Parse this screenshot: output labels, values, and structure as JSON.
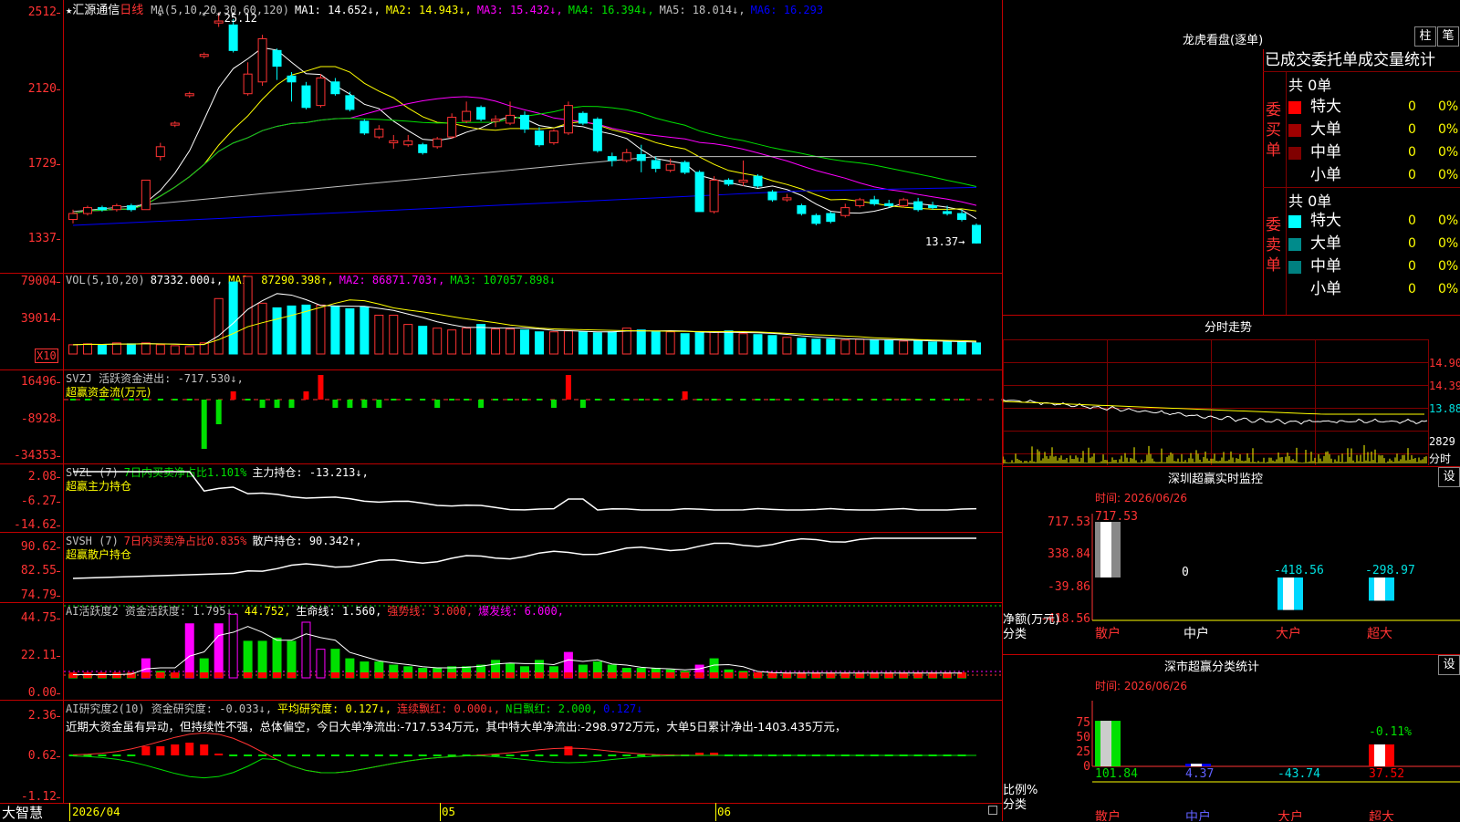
{
  "stock": {
    "star": "★",
    "name": "汇源通信",
    "period": "日线"
  },
  "main_legend": [
    {
      "t": "MA(5,10,20,30,60,120)",
      "c": "#c0c0c0"
    },
    {
      "t": "MA1: 14.652↓,",
      "c": "#ffffff"
    },
    {
      "t": "MA2: 14.943↓,",
      "c": "#ffff00"
    },
    {
      "t": "MA3: 15.432↓,",
      "c": "#ff00ff"
    },
    {
      "t": "MA4: 16.394↓,",
      "c": "#00e000"
    },
    {
      "t": "MA5: 18.014↓,",
      "c": "#c0c0c0"
    },
    {
      "t": "MA6: 16.293",
      "c": "#0000ff"
    }
  ],
  "high_label": "25.12",
  "last_label": "13.37→",
  "main_axis": [
    "2512",
    "2120",
    "1729",
    "1337"
  ],
  "vol_legend": [
    {
      "t": "VOL(5,10,20)",
      "c": "#c0c0c0"
    },
    {
      "t": "87332.000↓,",
      "c": "#ffffff"
    },
    {
      "t": "MA1: 87290.398↑,",
      "c": "#ffff00"
    },
    {
      "t": "MA2: 86871.703↑,",
      "c": "#ff00ff"
    },
    {
      "t": "MA3: 107057.898↓",
      "c": "#00e000"
    }
  ],
  "vol_axis": [
    "79004",
    "39014"
  ],
  "vol_unit": "X10",
  "svzj_legend": [
    {
      "t": "SVZJ  活跃资金进出: -717.530↓,",
      "c": "#c0c0c0"
    }
  ],
  "svzj_sub": "超赢资金流(万元)",
  "svzj_axis": [
    "16496",
    "-8928",
    "-34353"
  ],
  "svzl_legend": [
    {
      "t": "SVZL (7)",
      "c": "#c0c0c0"
    },
    {
      "t": "7日内买卖净占比1.101%",
      "c": "#00e000"
    },
    {
      "t": "主力持仓: -13.213↓,",
      "c": "#ffffff"
    }
  ],
  "svzl_sub": "超赢主力持仓",
  "svzl_axis": [
    "2.08",
    "-6.27",
    "-14.62"
  ],
  "svsh_legend": [
    {
      "t": "SVSH (7)",
      "c": "#c0c0c0"
    },
    {
      "t": "7日内买卖净占比0.835%",
      "c": "#ff3333"
    },
    {
      "t": "散户持仓: 90.342↑,",
      "c": "#ffffff"
    }
  ],
  "svsh_sub": "超赢散户持仓",
  "svsh_axis": [
    "90.62",
    "82.55",
    "74.79"
  ],
  "ai1_legend": [
    {
      "t": "AI活跃度2 资金活跃度: 1.795↓,",
      "c": "#c0c0c0"
    },
    {
      "t": "44.752,",
      "c": "#ffff00"
    },
    {
      "t": "生命线: 1.560,",
      "c": "#ffffff"
    },
    {
      "t": "强势线: 3.000,",
      "c": "#ff3333"
    },
    {
      "t": "爆发线: 6.000,",
      "c": "#ff00ff"
    }
  ],
  "ai1_axis": [
    "44.75",
    "22.11",
    "0.00"
  ],
  "ai2_legend": [
    {
      "t": "AI研究度2(10) 资金研究度: -0.033↓,",
      "c": "#c0c0c0"
    },
    {
      "t": "平均研究度: 0.127↓,",
      "c": "#ffff00"
    },
    {
      "t": "连续飘红: 0.000↓,",
      "c": "#ff3333"
    },
    {
      "t": "N日飘红: 2.000,",
      "c": "#00e000"
    },
    {
      "t": "0.127↓",
      "c": "#0000ff"
    }
  ],
  "ai2_note": "近期大资金虽有异动，但持续性不强，总体偏空，今日大单净流出:-717.534万元，其中特大单净流出:-298.972万元，大单5日累计净出-1403.435万元，",
  "ai2_axis": [
    "2.36",
    "0.62",
    "-1.12"
  ],
  "date_axis": [
    "2026/04",
    "05",
    "06"
  ],
  "brand": "大智慧",
  "lhb": {
    "title": "龙虎看盘(逐单)",
    "btn_bar": "柱",
    "btn_pen": "笔",
    "header": "已成交委托单成交量统计",
    "buy": {
      "side": "委买单",
      "total": "共 0单",
      "rows": [
        {
          "name": "特大",
          "v": "0",
          "p": "0%",
          "c": "#ff0000"
        },
        {
          "name": "大单",
          "v": "0",
          "p": "0%",
          "c": "#a00000"
        },
        {
          "name": "中单",
          "v": "0",
          "p": "0%",
          "c": "#800000"
        },
        {
          "name": "小单",
          "v": "0",
          "p": "0%",
          "c": ""
        }
      ]
    },
    "sell": {
      "side": "委卖单",
      "total": "共 0单",
      "rows": [
        {
          "name": "特大",
          "v": "0",
          "p": "0%",
          "c": "#00ffff"
        },
        {
          "name": "大单",
          "v": "0",
          "p": "0%",
          "c": "#008b8b"
        },
        {
          "name": "中单",
          "v": "0",
          "p": "0%",
          "c": "#008080"
        },
        {
          "name": "小单",
          "v": "0",
          "p": "0%",
          "c": ""
        }
      ]
    }
  },
  "intraday": {
    "title": "分时走势",
    "axis": [
      "14.90",
      "14.39",
      "13.88",
      "2829"
    ],
    "unit": "分时"
  },
  "sz_monitor": {
    "title": "深圳超赢实时监控",
    "btn": "设",
    "time": "时间: 2026/06/26",
    "axis": [
      "717.53",
      "338.84",
      "-39.86",
      "-418.56"
    ],
    "ylabel": "净额(万元)",
    "xlabel": "分类",
    "cats": [
      "散户",
      "中户",
      "大户",
      "超大"
    ],
    "values": [
      717.53,
      0,
      -418.56,
      -298.97
    ],
    "value_labels": [
      "717.53",
      "0",
      "-418.56",
      "-298.97"
    ]
  },
  "sz_class": {
    "title": "深市超赢分类统计",
    "btn": "设",
    "time": "时间: 2026/06/26",
    "axis": [
      "75",
      "50",
      "25",
      "0"
    ],
    "ylabel": "比例%",
    "xlabel": "分类",
    "cats": [
      "散户",
      "中户",
      "大户",
      "超大"
    ],
    "values": [
      101.84,
      4.37,
      -43.74,
      37.52
    ],
    "value_labels": [
      "101.84",
      "4.37",
      "-43.74",
      "37.52"
    ],
    "extra_label": "-0.11%"
  },
  "chart_data": {
    "type": "candlestick",
    "title": "汇源通信 日线",
    "ylim": [
      13.37,
      25.12
    ],
    "candles": [
      {
        "o": 14.6,
        "c": 14.9,
        "h": 15.1,
        "l": 14.4
      },
      {
        "o": 14.9,
        "c": 15.2,
        "h": 15.3,
        "l": 14.8
      },
      {
        "o": 15.2,
        "c": 15.1,
        "h": 15.3,
        "l": 15.0
      },
      {
        "o": 15.1,
        "c": 15.3,
        "h": 15.4,
        "l": 15.0
      },
      {
        "o": 15.3,
        "c": 15.1,
        "h": 15.4,
        "l": 15.0
      },
      {
        "o": 15.1,
        "c": 16.6,
        "h": 16.6,
        "l": 15.1
      },
      {
        "o": 17.8,
        "c": 18.3,
        "h": 18.5,
        "l": 17.6
      },
      {
        "o": 19.4,
        "c": 19.5,
        "h": 19.6,
        "l": 19.3
      },
      {
        "o": 20.9,
        "c": 21.0,
        "h": 21.1,
        "l": 20.8
      },
      {
        "o": 22.9,
        "c": 23.0,
        "h": 23.1,
        "l": 22.8
      },
      {
        "o": 24.6,
        "c": 24.7,
        "h": 25.12,
        "l": 24.4
      },
      {
        "o": 24.5,
        "c": 23.2,
        "h": 24.8,
        "l": 23.1
      },
      {
        "o": 21.0,
        "c": 22.0,
        "h": 22.6,
        "l": 20.9
      },
      {
        "o": 21.6,
        "c": 23.8,
        "h": 24.0,
        "l": 21.4
      },
      {
        "o": 23.2,
        "c": 22.4,
        "h": 23.3,
        "l": 21.7
      },
      {
        "o": 21.9,
        "c": 21.6,
        "h": 22.1,
        "l": 20.6
      },
      {
        "o": 21.4,
        "c": 20.3,
        "h": 21.6,
        "l": 20.2
      },
      {
        "o": 20.4,
        "c": 21.8,
        "h": 22.0,
        "l": 20.3
      },
      {
        "o": 21.6,
        "c": 21.0,
        "h": 21.8,
        "l": 20.9
      },
      {
        "o": 20.9,
        "c": 20.2,
        "h": 21.1,
        "l": 20.1
      },
      {
        "o": 19.6,
        "c": 19.0,
        "h": 19.7,
        "l": 18.9
      },
      {
        "o": 18.8,
        "c": 19.2,
        "h": 19.4,
        "l": 18.7
      },
      {
        "o": 18.5,
        "c": 18.6,
        "h": 18.9,
        "l": 18.2
      },
      {
        "o": 18.4,
        "c": 18.6,
        "h": 18.9,
        "l": 18.3
      },
      {
        "o": 18.4,
        "c": 18.0,
        "h": 18.5,
        "l": 17.9
      },
      {
        "o": 18.3,
        "c": 18.7,
        "h": 18.8,
        "l": 18.2
      },
      {
        "o": 18.8,
        "c": 19.8,
        "h": 20.0,
        "l": 18.7
      },
      {
        "o": 19.6,
        "c": 20.1,
        "h": 20.6,
        "l": 19.5
      },
      {
        "o": 20.3,
        "c": 19.7,
        "h": 20.4,
        "l": 19.6
      },
      {
        "o": 19.6,
        "c": 19.7,
        "h": 19.9,
        "l": 19.3
      },
      {
        "o": 19.5,
        "c": 19.9,
        "h": 20.6,
        "l": 19.4
      },
      {
        "o": 19.9,
        "c": 19.2,
        "h": 20.1,
        "l": 19.0
      },
      {
        "o": 19.1,
        "c": 18.4,
        "h": 19.3,
        "l": 18.3
      },
      {
        "o": 18.5,
        "c": 19.1,
        "h": 19.2,
        "l": 18.4
      },
      {
        "o": 19.0,
        "c": 20.4,
        "h": 20.6,
        "l": 18.9
      },
      {
        "o": 20.0,
        "c": 19.5,
        "h": 20.1,
        "l": 19.4
      },
      {
        "o": 19.7,
        "c": 18.1,
        "h": 19.8,
        "l": 18.0
      },
      {
        "o": 17.8,
        "c": 17.6,
        "h": 18.0,
        "l": 17.3
      },
      {
        "o": 17.6,
        "c": 18.0,
        "h": 18.2,
        "l": 17.5
      },
      {
        "o": 17.9,
        "c": 17.6,
        "h": 18.4,
        "l": 17.0
      },
      {
        "o": 17.6,
        "c": 17.2,
        "h": 17.8,
        "l": 17.0
      },
      {
        "o": 17.1,
        "c": 17.4,
        "h": 17.7,
        "l": 17.0
      },
      {
        "o": 17.5,
        "c": 17.0,
        "h": 17.6,
        "l": 16.9
      },
      {
        "o": 17.0,
        "c": 15.0,
        "h": 17.1,
        "l": 15.0
      },
      {
        "o": 15.0,
        "c": 16.6,
        "h": 16.8,
        "l": 14.9
      },
      {
        "o": 16.6,
        "c": 16.4,
        "h": 16.7,
        "l": 16.3
      },
      {
        "o": 16.5,
        "c": 16.6,
        "h": 17.6,
        "l": 16.3
      },
      {
        "o": 16.8,
        "c": 16.3,
        "h": 16.9,
        "l": 16.2
      },
      {
        "o": 16.0,
        "c": 15.6,
        "h": 16.1,
        "l": 15.5
      },
      {
        "o": 15.6,
        "c": 15.7,
        "h": 15.9,
        "l": 15.5
      },
      {
        "o": 15.3,
        "c": 14.9,
        "h": 15.4,
        "l": 14.8
      },
      {
        "o": 14.8,
        "c": 14.4,
        "h": 14.9,
        "l": 14.3
      },
      {
        "o": 14.9,
        "c": 14.5,
        "h": 15.0,
        "l": 14.4
      },
      {
        "o": 14.8,
        "c": 15.2,
        "h": 15.4,
        "l": 14.7
      },
      {
        "o": 15.3,
        "c": 15.6,
        "h": 15.7,
        "l": 15.2
      },
      {
        "o": 15.6,
        "c": 15.4,
        "h": 15.8,
        "l": 15.3
      },
      {
        "o": 15.4,
        "c": 15.3,
        "h": 15.6,
        "l": 15.2
      },
      {
        "o": 15.3,
        "c": 15.6,
        "h": 15.7,
        "l": 15.2
      },
      {
        "o": 15.5,
        "c": 15.1,
        "h": 15.7,
        "l": 15.0
      },
      {
        "o": 15.3,
        "c": 15.2,
        "h": 15.5,
        "l": 15.1
      },
      {
        "o": 15.0,
        "c": 14.9,
        "h": 15.3,
        "l": 14.8
      },
      {
        "o": 14.9,
        "c": 14.6,
        "h": 15.1,
        "l": 14.5
      },
      {
        "o": 14.3,
        "c": 13.4,
        "h": 14.4,
        "l": 13.37
      }
    ]
  }
}
